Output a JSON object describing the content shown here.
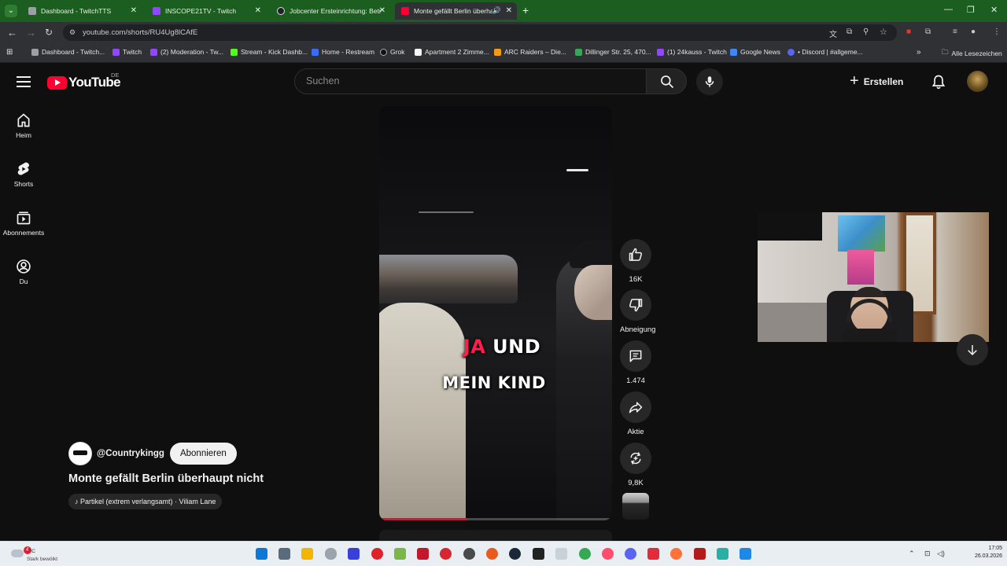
{
  "browser": {
    "tabs": [
      {
        "label": "Dashboard - TwitchTTS",
        "favicon_color": "#9aa0a6"
      },
      {
        "label": "INSCOPE21TV - Twitch",
        "favicon_color": "#9146ff"
      },
      {
        "label": "Jobcenter Ersteinrichtung: Betr",
        "favicon_color": "#202124"
      },
      {
        "label": "Monte gefällt Berlin überha",
        "favicon_color": "#ff0033"
      }
    ],
    "url": "youtube.com/shorts/RU4Ug8lCAfE",
    "bookmarks": [
      {
        "label": "Dashboard - Twitch...",
        "color": "#9aa0a6"
      },
      {
        "label": "Twitch",
        "color": "#9146ff"
      },
      {
        "label": "(2) Moderation - Tw...",
        "color": "#9146ff"
      },
      {
        "label": "Stream - Kick Dashb...",
        "color": "#53fc18"
      },
      {
        "label": "Home - Restream",
        "color": "#3b6cf6"
      },
      {
        "label": "Grok",
        "color": "#111111"
      },
      {
        "label": "Apartment 2 Zimme...",
        "color": "#f5f5f5"
      },
      {
        "label": "ARC Raiders – Die...",
        "color": "#f39c12"
      },
      {
        "label": "Dillinger Str. 25, 470...",
        "color": "#34a853"
      },
      {
        "label": "(1) 24kauss - Twitch",
        "color": "#9146ff"
      },
      {
        "label": "Google News",
        "color": "#4285f4"
      },
      {
        "label": "• Discord | #allgeme...",
        "color": "#5865f2"
      }
    ],
    "all_bookmarks_label": "Alle Lesezeichen"
  },
  "youtube": {
    "logo_text": "YouTube",
    "country_code": "DE",
    "search_placeholder": "Suchen",
    "create_label": "Erstellen",
    "sidebar": [
      {
        "label": "Heim",
        "icon": "home-icon"
      },
      {
        "label": "Shorts",
        "icon": "shorts-icon"
      },
      {
        "label": "Abonnements",
        "icon": "subscriptions-icon"
      },
      {
        "label": "Du",
        "icon": "you-icon"
      }
    ],
    "short": {
      "caption_highlight": "JA",
      "caption_line1_rest": " UND",
      "caption_line2": "MEIN KIND",
      "progress": 0.38,
      "accent": "#ff0033",
      "caption_highlight_color": "#ff1f4d"
    },
    "actions": {
      "like_count": "16K",
      "dislike_label": "Abneigung",
      "comment_count": "1.474",
      "share_label": "Aktie",
      "remix_count": "9,8K"
    },
    "channel": {
      "handle": "@Countrykingg",
      "subscribe_label": "Abonnieren"
    },
    "video_title": "Monte gefällt Berlin überhaupt nicht",
    "music": "Partikel (extrem verlangsamt) · Viliam Lane"
  },
  "taskbar": {
    "weather_temp": "7°C",
    "weather_text": "Stark bewölkt",
    "weather_badge": "4",
    "clock_time": "17:05",
    "clock_date": "26.03.2026"
  }
}
